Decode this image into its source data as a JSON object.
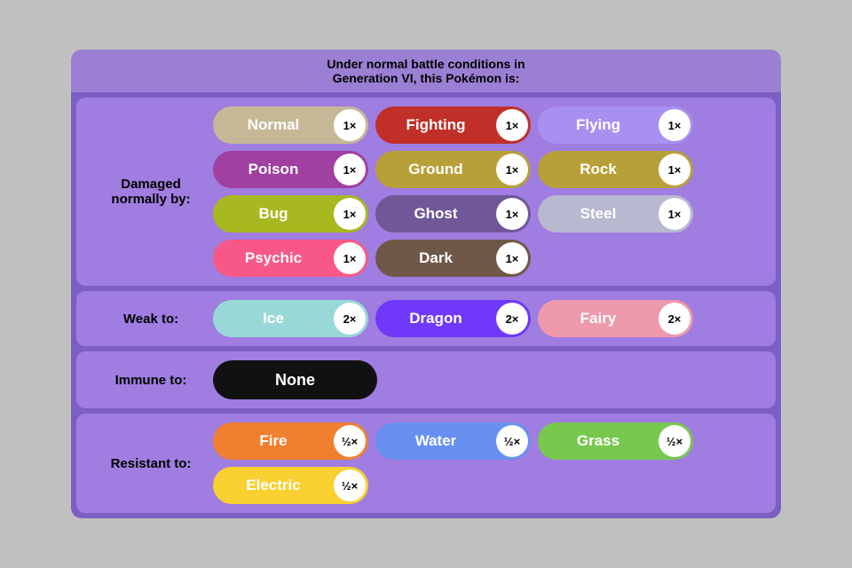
{
  "header": {
    "line1": "Under normal battle conditions in",
    "line2": "Generation VI, this Pokémon is:"
  },
  "sections": {
    "damaged_normally": {
      "label": "Damaged\nnormally by:",
      "types": [
        {
          "name": "Normal",
          "multiplier": "1×",
          "color": "normal-type"
        },
        {
          "name": "Fighting",
          "multiplier": "1×",
          "color": "fighting-type"
        },
        {
          "name": "Flying",
          "multiplier": "1×",
          "color": "flying-type"
        },
        {
          "name": "Poison",
          "multiplier": "1×",
          "color": "poison-type"
        },
        {
          "name": "Ground",
          "multiplier": "1×",
          "color": "ground-type"
        },
        {
          "name": "Rock",
          "multiplier": "1×",
          "color": "rock-type"
        },
        {
          "name": "Bug",
          "multiplier": "1×",
          "color": "bug-type"
        },
        {
          "name": "Ghost",
          "multiplier": "1×",
          "color": "ghost-type"
        },
        {
          "name": "Steel",
          "multiplier": "1×",
          "color": "steel-type"
        },
        {
          "name": "Psychic",
          "multiplier": "1×",
          "color": "psychic-type"
        },
        {
          "name": "Dark",
          "multiplier": "1×",
          "color": "dark-type"
        }
      ]
    },
    "weak_to": {
      "label": "Weak to:",
      "types": [
        {
          "name": "Ice",
          "multiplier": "2×",
          "color": "ice-type"
        },
        {
          "name": "Dragon",
          "multiplier": "2×",
          "color": "dragon-type"
        },
        {
          "name": "Fairy",
          "multiplier": "2×",
          "color": "fairy-type"
        }
      ]
    },
    "immune_to": {
      "label": "Immune to:",
      "none": "None"
    },
    "resistant_to": {
      "label": "Resistant to:",
      "types": [
        {
          "name": "Fire",
          "multiplier": "½×",
          "color": "fire-type"
        },
        {
          "name": "Water",
          "multiplier": "½×",
          "color": "water-type"
        },
        {
          "name": "Grass",
          "multiplier": "½×",
          "color": "grass-type"
        },
        {
          "name": "Electric",
          "multiplier": "½×",
          "color": "electric-type"
        }
      ]
    }
  }
}
